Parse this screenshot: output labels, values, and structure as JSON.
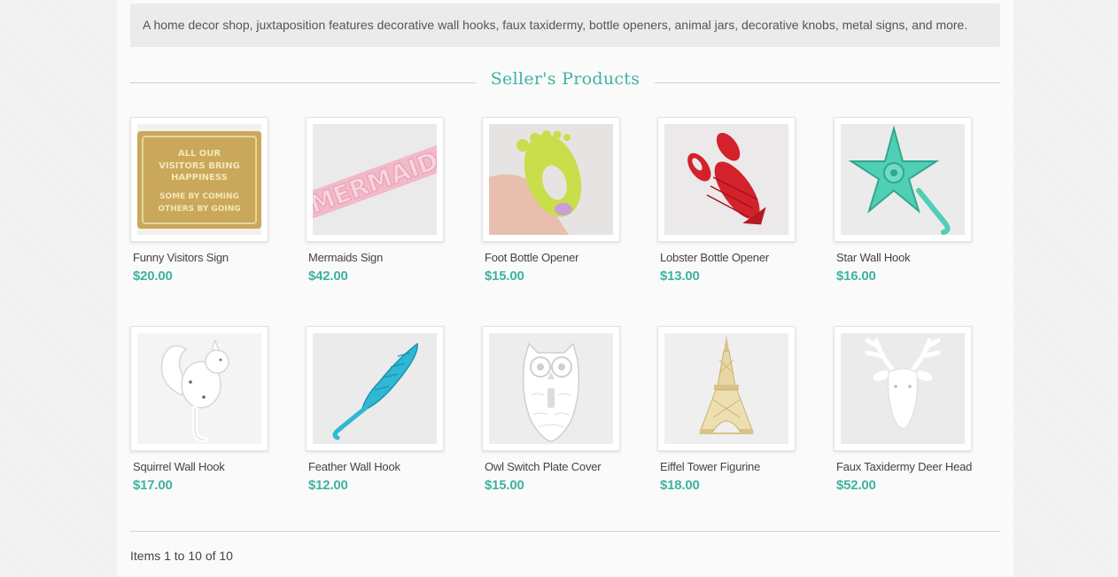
{
  "shop": {
    "description": "A home decor shop, juxtaposition features decorative wall hooks, faux taxidermy, bottle openers, animal jars, decorative knobs, metal signs, and more."
  },
  "section": {
    "title": "Seller's Products"
  },
  "colors": {
    "accent": "#3fb3a0",
    "text": "#444444",
    "description_bg": "#ebebeb"
  },
  "products": [
    {
      "name": "Funny Visitors Sign",
      "price": "$20.00",
      "image": "visitors-sign-image"
    },
    {
      "name": "Mermaids Sign",
      "price": "$42.00",
      "image": "mermaids-sign-image"
    },
    {
      "name": "Foot Bottle Opener",
      "price": "$15.00",
      "image": "foot-opener-image"
    },
    {
      "name": "Lobster Bottle Opener",
      "price": "$13.00",
      "image": "lobster-opener-image"
    },
    {
      "name": "Star Wall Hook",
      "price": "$16.00",
      "image": "star-hook-image"
    },
    {
      "name": "Squirrel Wall Hook",
      "price": "$17.00",
      "image": "squirrel-hook-image"
    },
    {
      "name": "Feather Wall Hook",
      "price": "$12.00",
      "image": "feather-hook-image"
    },
    {
      "name": "Owl Switch Plate Cover",
      "price": "$15.00",
      "image": "owl-plate-image"
    },
    {
      "name": "Eiffel Tower Figurine",
      "price": "$18.00",
      "image": "eiffel-figurine-image"
    },
    {
      "name": "Faux Taxidermy Deer Head",
      "price": "$52.00",
      "image": "deer-head-image"
    }
  ],
  "sign_text": {
    "line1": "ALL OUR",
    "line2": "VISITORS BRING",
    "line3": "HAPPINESS",
    "line4": "SOME BY COMING",
    "line5": "OTHERS BY GOING",
    "mermaids": "MERMAIDS"
  },
  "pagination": {
    "text": "Items 1 to 10 of 10"
  }
}
